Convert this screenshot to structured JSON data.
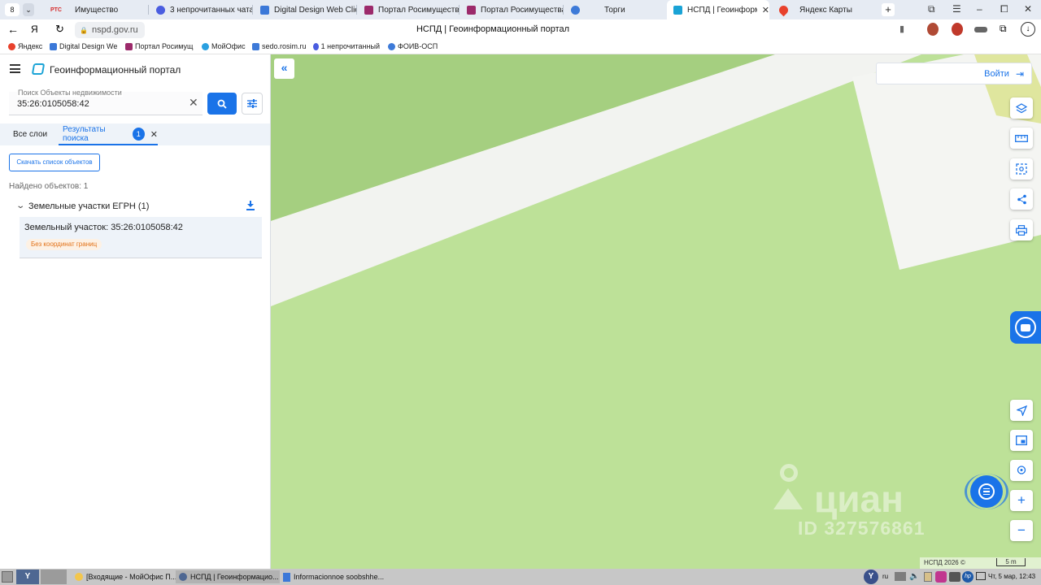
{
  "browser": {
    "tab_counter": "8",
    "tabs": [
      {
        "label": "Имущество",
        "fav": "#d62b2b",
        "fav_text": "РТС"
      },
      {
        "label": "3 непрочитанных чата",
        "fav": "#4a5de0"
      },
      {
        "label": "Digital Design Web Clien",
        "fav": "#3b78d8"
      },
      {
        "label": "Портал Росимущества",
        "fav": "#9c2a6b"
      },
      {
        "label": "Портал Росимущества",
        "fav": "#9c2a6b"
      },
      {
        "label": "Торги",
        "fav": "#3d7ad8"
      },
      {
        "label": "НСПД | Геоинформац",
        "fav": "#1aa3d6"
      },
      {
        "label": "Яндекс Карты",
        "fav": "#e8412c"
      }
    ],
    "address": "nspd.gov.ru",
    "page_title": "НСПД | Геоинформационный портал",
    "bookmarks": [
      {
        "label": "Яндекс",
        "fav": "#e8412c"
      },
      {
        "label": "Digital Design We",
        "fav": "#3b78d8"
      },
      {
        "label": "Портал Росимущ",
        "fav": "#9c2a6b"
      },
      {
        "label": "МойОфис",
        "fav": "#2aa0e0"
      },
      {
        "label": "sedo.rosim.ru",
        "fav": "#3d7ad8"
      },
      {
        "label": "1 непрочитанный",
        "fav": "#4a5de0"
      },
      {
        "label": "ФОИВ-ОСП",
        "fav": "#3d7ad8"
      }
    ]
  },
  "portal": {
    "title": "Геоинформационный портал",
    "search": {
      "label": "Поиск Объекты недвижимости",
      "value": "35:26:0105058:42"
    },
    "tabs": {
      "all_layers": "Все слои",
      "results": "Результаты поиска",
      "results_count": "1"
    },
    "download_button": "Скачать список объектов",
    "found_text": "Найдено объектов: 1",
    "group_title": "Земельные участки ЕГРН (1)",
    "result": {
      "title": "Земельный участок: 35:26:0105058:42",
      "badge": "Без координат границ"
    }
  },
  "map": {
    "login": "Войти",
    "watermark": "циан",
    "watermark_id": "ID 327576861",
    "copyright": "НСПД 2026 ©",
    "scale": "5 m"
  },
  "taskbar": {
    "items": [
      "[Входящие - МойОфис П...",
      "НСПД | Геоинформацио...",
      "Informacionnoe soobshhe..."
    ],
    "lang": "ru",
    "clock": "Чт, 5 мар, 12:43"
  },
  "colors": {
    "accent": "#1a73e8",
    "map_green": "#bde198",
    "map_dark_green": "#a5cf80",
    "badge_text": "#e2731a"
  }
}
